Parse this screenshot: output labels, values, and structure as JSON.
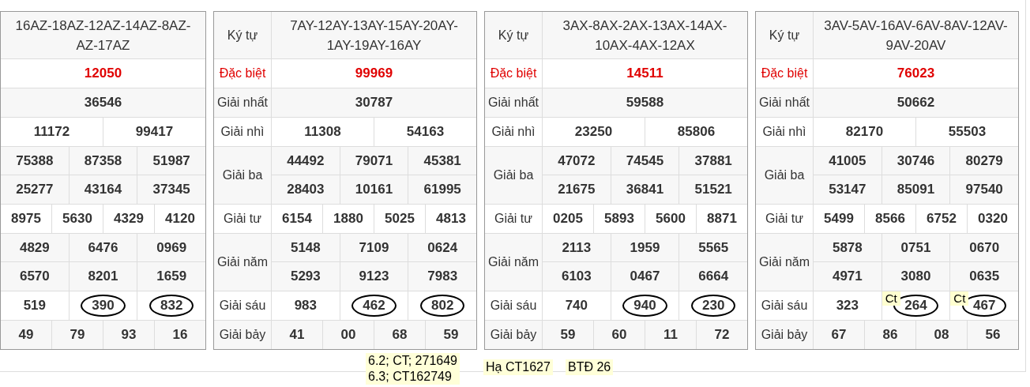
{
  "tables": [
    {
      "code": "16AZ-18AZ-12AZ-14AZ-8AZ-AZ-17AZ",
      "prizes": [
        {
          "kind": "special",
          "lines": [
            [
              {
                "value": "12050"
              }
            ]
          ]
        },
        {
          "kind": "normal",
          "lines": [
            [
              {
                "value": "36546"
              }
            ]
          ]
        },
        {
          "kind": "normal",
          "lines": [
            [
              {
                "value": "11172"
              },
              {
                "value": "99417"
              }
            ]
          ]
        },
        {
          "kind": "normal",
          "lines": [
            [
              {
                "value": "75388"
              },
              {
                "value": "87358"
              },
              {
                "value": "51987"
              }
            ],
            [
              {
                "value": "25277"
              },
              {
                "value": "43164"
              },
              {
                "value": "37345"
              }
            ]
          ]
        },
        {
          "kind": "normal",
          "lines": [
            [
              {
                "value": "8975"
              },
              {
                "value": "5630"
              },
              {
                "value": "4329"
              },
              {
                "value": "4120"
              }
            ]
          ]
        },
        {
          "kind": "normal",
          "lines": [
            [
              {
                "value": "4829"
              },
              {
                "value": "6476"
              },
              {
                "value": "0969"
              }
            ],
            [
              {
                "value": "6570"
              },
              {
                "value": "8201"
              },
              {
                "value": "1659"
              }
            ]
          ]
        },
        {
          "kind": "normal",
          "lines": [
            [
              {
                "value": "519",
                "circled": false
              },
              {
                "value": "390",
                "circled": true
              },
              {
                "value": "832",
                "circled": true
              }
            ]
          ]
        },
        {
          "kind": "normal",
          "lines": [
            [
              {
                "value": "49"
              },
              {
                "value": "79"
              },
              {
                "value": "93"
              },
              {
                "value": "16"
              }
            ]
          ]
        }
      ]
    },
    {
      "label_header": "Ký tự",
      "code": "7AY-12AY-13AY-15AY-20AY-1AY-19AY-16AY",
      "prizes": [
        {
          "kind": "special",
          "label": "Đặc biệt",
          "lines": [
            [
              {
                "value": "99969"
              }
            ]
          ]
        },
        {
          "kind": "normal",
          "label": "Giải nhất",
          "lines": [
            [
              {
                "value": "30787"
              }
            ]
          ]
        },
        {
          "kind": "normal",
          "label": "Giải nhì",
          "lines": [
            [
              {
                "value": "11308"
              },
              {
                "value": "54163"
              }
            ]
          ]
        },
        {
          "kind": "normal",
          "label": "Giải ba",
          "lines": [
            [
              {
                "value": "44492"
              },
              {
                "value": "79071"
              },
              {
                "value": "45381"
              }
            ],
            [
              {
                "value": "28403"
              },
              {
                "value": "10161"
              },
              {
                "value": "61995"
              }
            ]
          ]
        },
        {
          "kind": "normal",
          "label": "Giải tư",
          "lines": [
            [
              {
                "value": "6154"
              },
              {
                "value": "1880"
              },
              {
                "value": "5025"
              },
              {
                "value": "4813"
              }
            ]
          ]
        },
        {
          "kind": "normal",
          "label": "Giải năm",
          "lines": [
            [
              {
                "value": "5148"
              },
              {
                "value": "7109"
              },
              {
                "value": "0624"
              }
            ],
            [
              {
                "value": "5293"
              },
              {
                "value": "9123"
              },
              {
                "value": "7983"
              }
            ]
          ]
        },
        {
          "kind": "normal",
          "label": "Giải sáu",
          "lines": [
            [
              {
                "value": "983",
                "circled": false
              },
              {
                "value": "462",
                "circled": true
              },
              {
                "value": "802",
                "circled": true
              }
            ]
          ]
        },
        {
          "kind": "normal",
          "label": "Giải bảy",
          "lines": [
            [
              {
                "value": "41"
              },
              {
                "value": "00"
              },
              {
                "value": "68"
              },
              {
                "value": "59"
              }
            ]
          ]
        }
      ]
    },
    {
      "label_header": "Ký tự",
      "code": "3AX-8AX-2AX-13AX-14AX-10AX-4AX-12AX",
      "prizes": [
        {
          "kind": "special",
          "label": "Đặc biệt",
          "lines": [
            [
              {
                "value": "14511"
              }
            ]
          ]
        },
        {
          "kind": "normal",
          "label": "Giải nhất",
          "lines": [
            [
              {
                "value": "59588"
              }
            ]
          ]
        },
        {
          "kind": "normal",
          "label": "Giải nhì",
          "lines": [
            [
              {
                "value": "23250"
              },
              {
                "value": "85806"
              }
            ]
          ]
        },
        {
          "kind": "normal",
          "label": "Giải ba",
          "lines": [
            [
              {
                "value": "47072"
              },
              {
                "value": "74545"
              },
              {
                "value": "37881"
              }
            ],
            [
              {
                "value": "21675"
              },
              {
                "value": "36841"
              },
              {
                "value": "51521"
              }
            ]
          ]
        },
        {
          "kind": "normal",
          "label": "Giải tư",
          "lines": [
            [
              {
                "value": "0205"
              },
              {
                "value": "5893"
              },
              {
                "value": "5600"
              },
              {
                "value": "8871"
              }
            ]
          ]
        },
        {
          "kind": "normal",
          "label": "Giải năm",
          "lines": [
            [
              {
                "value": "2113"
              },
              {
                "value": "1959"
              },
              {
                "value": "5565"
              }
            ],
            [
              {
                "value": "6103"
              },
              {
                "value": "0467"
              },
              {
                "value": "6664"
              }
            ]
          ]
        },
        {
          "kind": "normal",
          "label": "Giải sáu",
          "lines": [
            [
              {
                "value": "740",
                "circled": false
              },
              {
                "value": "940",
                "circled": true
              },
              {
                "value": "230",
                "circled": true
              }
            ]
          ]
        },
        {
          "kind": "normal",
          "label": "Giải bảy",
          "lines": [
            [
              {
                "value": "59"
              },
              {
                "value": "60"
              },
              {
                "value": "11"
              },
              {
                "value": "72"
              }
            ]
          ]
        }
      ]
    },
    {
      "label_header": "Ký tự",
      "code": "3AV-5AV-16AV-6AV-8AV-12AV-9AV-20AV",
      "prizes": [
        {
          "kind": "special",
          "label": "Đặc biệt",
          "lines": [
            [
              {
                "value": "76023"
              }
            ]
          ]
        },
        {
          "kind": "normal",
          "label": "Giải nhất",
          "lines": [
            [
              {
                "value": "50662"
              }
            ]
          ]
        },
        {
          "kind": "normal",
          "label": "Giải nhì",
          "lines": [
            [
              {
                "value": "82170"
              },
              {
                "value": "55503"
              }
            ]
          ]
        },
        {
          "kind": "normal",
          "label": "Giải ba",
          "lines": [
            [
              {
                "value": "41005"
              },
              {
                "value": "30746"
              },
              {
                "value": "80279"
              }
            ],
            [
              {
                "value": "53147"
              },
              {
                "value": "85091"
              },
              {
                "value": "97540"
              }
            ]
          ]
        },
        {
          "kind": "normal",
          "label": "Giải tư",
          "lines": [
            [
              {
                "value": "5499"
              },
              {
                "value": "8566"
              },
              {
                "value": "6752"
              },
              {
                "value": "0320"
              }
            ]
          ]
        },
        {
          "kind": "normal",
          "label": "Giải năm",
          "lines": [
            [
              {
                "value": "5878"
              },
              {
                "value": "0751"
              },
              {
                "value": "0670"
              }
            ],
            [
              {
                "value": "4971"
              },
              {
                "value": "3080"
              },
              {
                "value": "0635"
              }
            ]
          ]
        },
        {
          "kind": "normal",
          "label": "Giải sáu",
          "lines": [
            [
              {
                "value": "323",
                "circled": false
              },
              {
                "value": "264",
                "circled": true,
                "note": "Ct"
              },
              {
                "value": "467",
                "circled": true,
                "note": "Ct"
              }
            ]
          ]
        },
        {
          "kind": "normal",
          "label": "Giải bảy",
          "lines": [
            [
              {
                "value": "67"
              },
              {
                "value": "86"
              },
              {
                "value": "08"
              },
              {
                "value": "56"
              }
            ]
          ]
        }
      ]
    }
  ],
  "notes": [
    {
      "lines": [
        "6.2; CT; 271649",
        "6.3; CT162749"
      ]
    },
    {
      "lines": [
        "Hạ CT1627"
      ]
    },
    {
      "lines": [
        "BTĐ 26"
      ]
    }
  ]
}
